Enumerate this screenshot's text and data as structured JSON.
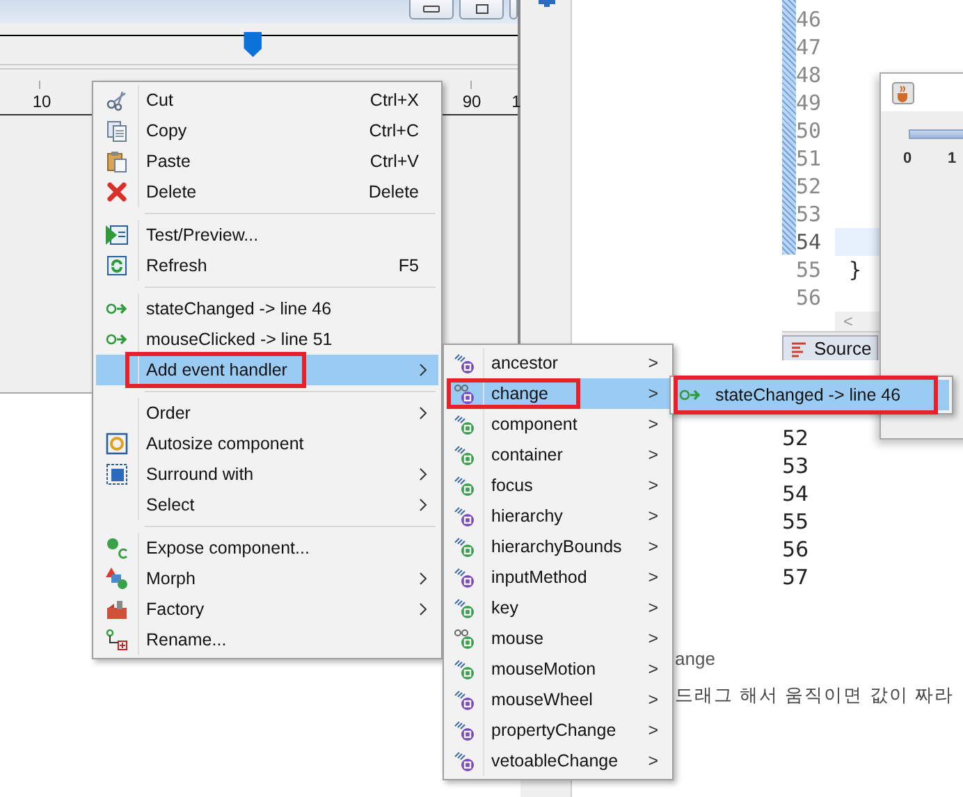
{
  "designer": {
    "slider": {
      "level": 0.49
    },
    "ruler_labels": [
      "10",
      "90",
      "1"
    ]
  },
  "editor": {
    "line_numbers": [
      {
        "number": "46",
        "current": false
      },
      {
        "number": "47",
        "current": false
      },
      {
        "number": "48",
        "current": false
      },
      {
        "number": "49",
        "current": false
      },
      {
        "number": "50",
        "current": false
      },
      {
        "number": "51",
        "current": false
      },
      {
        "number": "52",
        "current": false
      },
      {
        "number": "53",
        "current": false
      },
      {
        "number": "54",
        "current": true
      },
      {
        "number": "55",
        "current": false
      },
      {
        "number": "56",
        "current": false
      }
    ],
    "code": "}",
    "scroll_arrow": "<",
    "tab": "Source"
  },
  "preview": {
    "slider_labels": [
      "0",
      "1"
    ]
  },
  "output_lines": [
    "52",
    "53",
    "54",
    "55",
    "56",
    "57"
  ],
  "blog": {
    "heading": "ange",
    "text": "드래그 해서 움직이면 값이 짜라"
  },
  "menu": {
    "items": [
      {
        "kind": "item",
        "label": "Cut",
        "shortcut": "Ctrl+X",
        "submenu": false,
        "selected": false,
        "annotated": false
      },
      {
        "kind": "item",
        "label": "Copy",
        "shortcut": "Ctrl+C",
        "submenu": false,
        "selected": false,
        "annotated": false
      },
      {
        "kind": "item",
        "label": "Paste",
        "shortcut": "Ctrl+V",
        "submenu": false,
        "selected": false,
        "annotated": false
      },
      {
        "kind": "item",
        "label": "Delete",
        "shortcut": "Delete",
        "submenu": false,
        "selected": false,
        "annotated": false
      },
      {
        "kind": "separator"
      },
      {
        "kind": "item",
        "label": "Test/Preview...",
        "submenu": false,
        "selected": false,
        "annotated": false
      },
      {
        "kind": "item",
        "label": "Refresh",
        "shortcut": "F5",
        "submenu": false,
        "selected": false,
        "annotated": false
      },
      {
        "kind": "separator"
      },
      {
        "kind": "item",
        "label": "stateChanged -> line 46",
        "submenu": false,
        "selected": false,
        "annotated": false
      },
      {
        "kind": "item",
        "label": "mouseClicked -> line 51",
        "submenu": false,
        "selected": false,
        "annotated": false
      },
      {
        "kind": "item",
        "label": "Add event handler",
        "submenu": true,
        "selected": true,
        "annotated": true
      },
      {
        "kind": "separator"
      },
      {
        "kind": "item",
        "label": "Order",
        "submenu": true,
        "selected": false,
        "annotated": false
      },
      {
        "kind": "item",
        "label": "Autosize component",
        "submenu": false,
        "selected": false,
        "annotated": false
      },
      {
        "kind": "item",
        "label": "Surround with",
        "submenu": true,
        "selected": false,
        "annotated": false
      },
      {
        "kind": "item",
        "label": "Select",
        "submenu": true,
        "selected": false,
        "annotated": false
      },
      {
        "kind": "separator"
      },
      {
        "kind": "item",
        "label": "Expose component...",
        "submenu": false,
        "selected": false,
        "annotated": false
      },
      {
        "kind": "item",
        "label": "Morph",
        "submenu": true,
        "selected": false,
        "annotated": false
      },
      {
        "kind": "item",
        "label": "Factory",
        "submenu": true,
        "selected": false,
        "annotated": false
      },
      {
        "kind": "item",
        "label": "Rename...",
        "submenu": false,
        "selected": false,
        "annotated": false
      }
    ]
  },
  "event_menu": {
    "items": [
      {
        "label": "ancestor",
        "selected": false,
        "annotated": false
      },
      {
        "label": "change",
        "selected": true,
        "annotated": true
      },
      {
        "label": "component",
        "selected": false,
        "annotated": false
      },
      {
        "label": "container",
        "selected": false,
        "annotated": false
      },
      {
        "label": "focus",
        "selected": false,
        "annotated": false
      },
      {
        "label": "hierarchy",
        "selected": false,
        "annotated": false
      },
      {
        "label": "hierarchyBounds",
        "selected": false,
        "annotated": false
      },
      {
        "label": "inputMethod",
        "selected": false,
        "annotated": false
      },
      {
        "label": "key",
        "selected": false,
        "annotated": false
      },
      {
        "label": "mouse",
        "selected": false,
        "annotated": false
      },
      {
        "label": "mouseMotion",
        "selected": false,
        "annotated": false
      },
      {
        "label": "mouseWheel",
        "selected": false,
        "annotated": false
      },
      {
        "label": "propertyChange",
        "selected": false,
        "annotated": false
      },
      {
        "label": "vetoableChange",
        "selected": false,
        "annotated": false
      }
    ],
    "arrow": ">"
  },
  "handler_menu": {
    "items": [
      {
        "label": "stateChanged -> line 46",
        "selected": true,
        "annotated": true
      }
    ]
  }
}
